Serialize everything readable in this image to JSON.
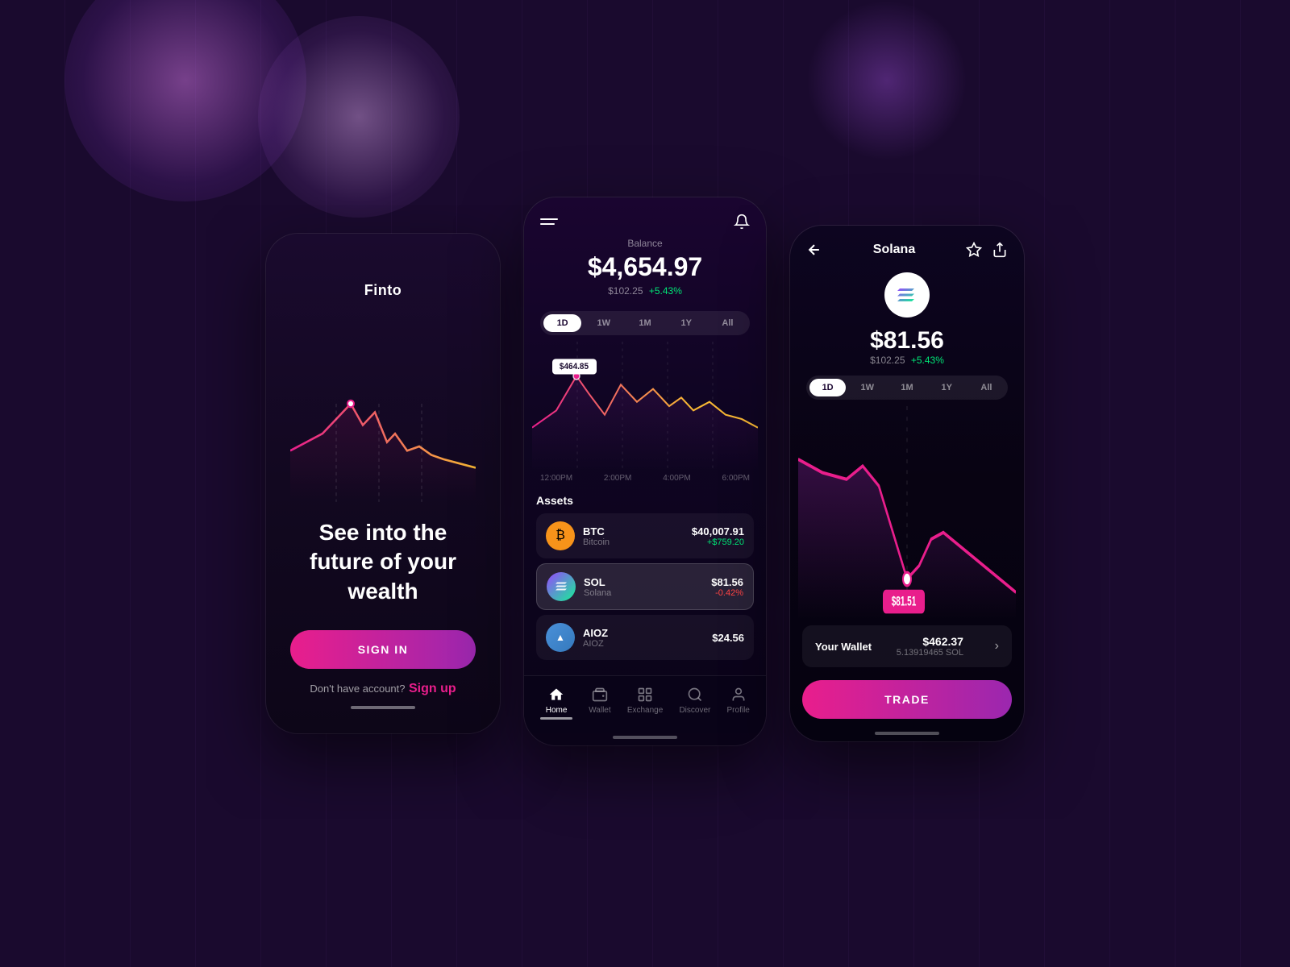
{
  "background": {
    "color": "#1a0a2e"
  },
  "phone1": {
    "logo": "Finto",
    "tagline": "See into the future of your wealth",
    "signin_label": "SIGN IN",
    "signup_text": "Don't have account?",
    "signup_link": "Sign up",
    "home_indicator": true
  },
  "phone2": {
    "balance_label": "Balance",
    "balance_amount": "$4,654.97",
    "balance_change": "$102.25",
    "balance_pct": "+5.43%",
    "timeframes": [
      "1D",
      "1W",
      "1M",
      "1Y",
      "All"
    ],
    "active_timeframe": "1D",
    "chart_tooltip": "$464.85",
    "chart_time_labels": [
      "12:00PM",
      "2:00PM",
      "4:00PM",
      "6:00PM"
    ],
    "assets_title": "Assets",
    "assets": [
      {
        "symbol": "BTC",
        "name": "Bitcoin",
        "price": "$40,007.91",
        "change": "+$759.20",
        "positive": true,
        "icon_type": "btc"
      },
      {
        "symbol": "SOL",
        "name": "Solana",
        "price": "$81.56",
        "change": "-0.42%",
        "positive": false,
        "icon_type": "sol",
        "highlighted": true
      },
      {
        "symbol": "AIOZ",
        "name": "AIOZ",
        "price": "$24.56",
        "change": "",
        "positive": false,
        "icon_type": "aioz"
      }
    ],
    "nav": [
      {
        "label": "Home",
        "icon": "home-icon",
        "active": true
      },
      {
        "label": "Wallet",
        "icon": "wallet-icon",
        "active": false
      },
      {
        "label": "Exchange",
        "icon": "exchange-icon",
        "active": false
      },
      {
        "label": "Discover",
        "icon": "discover-icon",
        "active": false
      },
      {
        "label": "Profile",
        "icon": "profile-icon",
        "active": false
      }
    ]
  },
  "phone3": {
    "back_label": "back",
    "title": "Solana",
    "price": "$81.56",
    "change": "$102.25",
    "change_pct": "+5.43%",
    "timeframes": [
      "1D",
      "1W",
      "1M",
      "1Y",
      "All"
    ],
    "active_timeframe": "1D",
    "chart_tooltip": "$81.51",
    "wallet_label": "Your Wallet",
    "wallet_usd": "$462.37",
    "wallet_sol": "5.13919465 SOL",
    "trade_label": "TRADE"
  }
}
